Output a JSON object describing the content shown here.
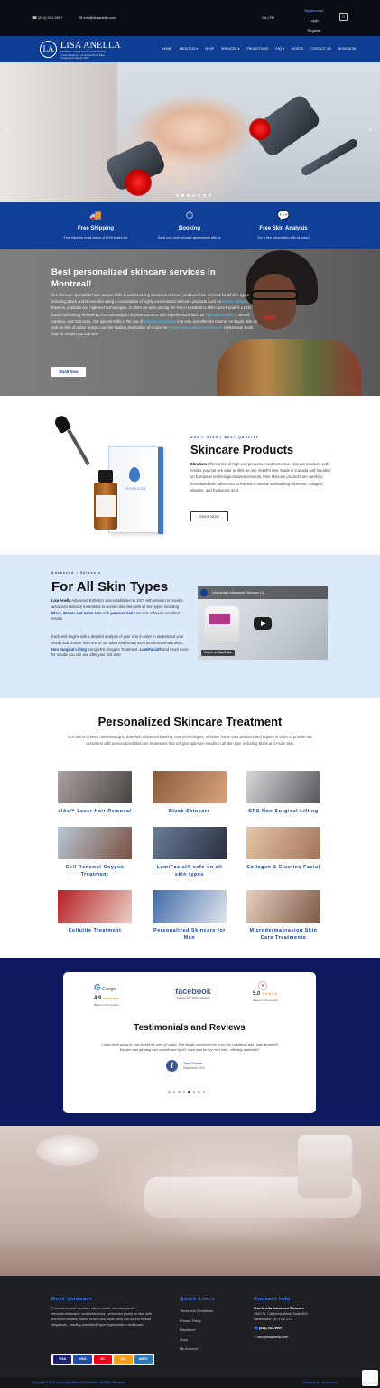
{
  "topbar": {
    "phone": "(514) 931-9997",
    "email": "info@lisaanella.com",
    "lang": "CA | FR",
    "account_title": "My Account",
    "login": "Login",
    "register": "Register",
    "cart_count": "0"
  },
  "nav": {
    "logo_mark": "LA",
    "logo_name": "LISA ANELLA",
    "logo_tagline": "LifeRique Anella Advanced Esthetics",
    "logo_sub": "In the Business of Customized Skin Treatments Since 1977",
    "menu": [
      "HOME",
      "ABOUT US ▾",
      "SHOP",
      "SERVICES ▾",
      "PROMOTIONS",
      "FAQ ▾",
      "VIDEOS",
      "CONTACT US",
      "BOOK NOW"
    ]
  },
  "hero": {
    "prev": "‹",
    "next": "›",
    "slide_count": 7,
    "active_slide": 1
  },
  "features": [
    {
      "icon": "🚚",
      "title": "Free Shipping",
      "sub": "Free shipping on all orders of $199 before tax"
    },
    {
      "icon": "⏱",
      "title": "Booking",
      "sub": "Book your next skincare appointment with us"
    },
    {
      "icon": "💬",
      "title": "Free Skin Analysis",
      "sub": "Get a free consultation with us today!"
    }
  ],
  "personalized": {
    "heading": "Best personalized skincare services in Montreal!",
    "p_a": "Our skincare specialists have unique skills in administering advanced skincare and laser hair removal for all skin types including Black and Brown skin using a combination of highly concentrated skincare products such as ",
    "p_hl1": "bovine collagen",
    "p_b": ", Elastine, peptides and high-end technologies. In 2004 we were among the first in Montreal to offer Lumi-Facial ® a LED based technology delivering chromotherapy to improve common skin imperfections such as ",
    "p_hl2": "hyperpigmentation",
    "p_c": ", dilated capillary, and mild acne. Our special skills in the use of ",
    "p_hl3": "Microdermabrasion",
    "p_d": " in a safe and effective manner on fragile skin as well as skin of colour makes ours the leading destination of choice for ",
    "p_hl4": "personalized advanced skincare",
    "p_e": " in Montreal! Book now for results you can see!",
    "button": "Book Now"
  },
  "products": {
    "eyebrow": "DON'T MISS | BEST QUALITY",
    "heading": "Skincare Products",
    "brand": "Ekradom",
    "text": " offers a line of high end preventive and corrective skincare products with results you can see after as little as one month's use. Made in Canada and founded on European technological advancements, their skincare products are carefully formulated with adherence to the skin's natural moisturizing elements; collagen, elastine, and hyaluronic acid.",
    "button": "SHOP NOW",
    "box_label": "EKRADOM"
  },
  "skintypes": {
    "eyebrow": "Advanced • Skincare",
    "heading": "For All Skin Types",
    "p1_brand": "Lisa Anella",
    "p1_a": " Advanced Esthetics was established in 1977 with mission to provide advanced skincare treatments to women and men with all skin types including ",
    "p1_b": "Black, Brown and Asian skin",
    "p1_c": " with ",
    "p1_d": "personalized",
    "p1_e": " care that achieves excellent results.",
    "p2_a": "Each visit begins with a detailed analysis of your skin in order to understand your needs and choose from one of our advanced facials such as Microdermabrasion, ",
    "p2_b": "Non Surgical Lifting",
    "p2_c": " using SRS, Oxygen Treatment, ",
    "p2_d": "LumiFacial®",
    "p2_e": " and much more for results you can see after your first visit!",
    "video_title": "Lisa Anella Advanced Skincare | M...",
    "watch_on": "Watch on",
    "yt": "YouTube"
  },
  "treatments": {
    "heading": "Personalized Skincare Treatment",
    "intro": "Our aim is to keep ourselves up to date with advanced training, new technologies, effective home care products and regime in order to provide our customers with personalized skincare treatments that will give optimum results in all skin type including Black and Asian skin.",
    "items": [
      {
        "label": "elōs™ Laser Hair Removal",
        "c1": "#a9a29f",
        "c2": "#4a4441"
      },
      {
        "label": "Black Skincare",
        "c1": "#8a5a3c",
        "c2": "#d9a47c"
      },
      {
        "label": "SRS Non-Surgical Lifting",
        "c1": "#d8d8da",
        "c2": "#55575b"
      },
      {
        "label": "Cell Renewal Oxygen Treatment",
        "c1": "#b7c7d6",
        "c2": "#7a5040"
      },
      {
        "label": "LumiFacial® safe on all skin types",
        "c1": "#6a7d98",
        "c2": "#2b2f40"
      },
      {
        "label": "Collagen & Elastine Facial",
        "c1": "#e6c6a6",
        "c2": "#a3745a"
      },
      {
        "label": "Cellulite Treatment",
        "c1": "#b61f26",
        "c2": "#e9cfc2"
      },
      {
        "label": "Personalized Skincare for Men",
        "c1": "#3f6aa6",
        "c2": "#e0e6ee"
      },
      {
        "label": "Microdermabrasion Skin Care Treatments",
        "c1": "#e8cfbd",
        "c2": "#7c5a47"
      }
    ]
  },
  "testimonials": {
    "google_rating": "4.9",
    "google_stars": "★★★★★",
    "google_sub": "Based on 53 reviews",
    "facebook": "facebook",
    "facebook_sub": "Followed by 3500 Followers",
    "fb_rating": "5.0",
    "fb_stars": "★★★★★",
    "fb_sub": "Based on 29 reviews",
    "heading": "Testimonials and Reviews",
    "quote": "I have been going to Lisa Anella for over 20 years. She finally convinced me to try the Lumifacial and I was amazed!! My skin was glowing and smooth and tight!!! Cant wait for my next one... officially addicted!!!",
    "author": "Tara Chaniel",
    "date": "Septembre 2019",
    "dots": 8,
    "active": 4
  },
  "footer": {
    "col1_title": "Best skincare",
    "col1_text": "Procedures such as laser hair removal, chemical peels, microdermabrasion and extractions, performed poorly on skin with enriched melanin (black, brown and asian skin) can sound to lead negatively - leading unwanted hyper pigmentation and scars.",
    "col2_title": "Quick Links",
    "links": [
      "Terms and Conditions",
      "Privacy Policy",
      "Disclaimer",
      "Shop",
      "My Account"
    ],
    "col3_title": "Contact Info",
    "company": "Lisa Anella Advanced Skincare",
    "address1": "4060 St. Catherine West, Suite 300",
    "address2": "Westmount, QC H3Z 2Z3",
    "phone": "(514) 931-9997",
    "email": "info@lisaanella.com",
    "cards": [
      "VISA",
      "VISA",
      "MC",
      "MC",
      "AMEX"
    ],
    "copyright": "Copyright © 2021 Lisa Anella Advanced Esthetics. All Rights Reserved.",
    "designed_by": "Designed by : Innovate.ca"
  },
  "colors": {
    "brand_blue": "#0e3d94",
    "navy": "#0d1a5f",
    "link_blue": "#56c4ff",
    "footer_bg": "#1f2024"
  }
}
